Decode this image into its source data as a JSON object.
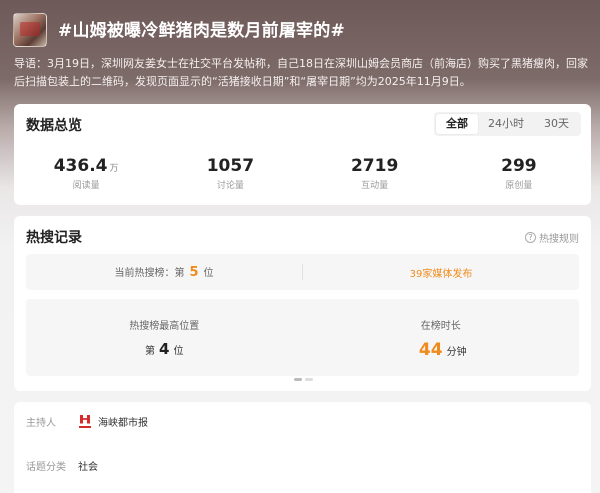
{
  "header": {
    "title": "#山姆被曝冷鲜猪肉是数月前屠宰的#",
    "lead": "导语：3月19日，深圳网友姜女士在社交平台发帖称，自己18日在深圳山姆会员商店（前海店）购买了黑猪瘦肉，回家后扫描包装上的二维码，发现页面显示的“活猪接收日期”和“屠宰日期”均为2025年11月9日。"
  },
  "overview": {
    "title": "数据总览",
    "tabs": [
      "全部",
      "24小时",
      "30天"
    ],
    "stats": [
      {
        "value": "436.4",
        "unit": "万",
        "label": "阅读量"
      },
      {
        "value": "1057",
        "unit": "",
        "label": "讨论量"
      },
      {
        "value": "2719",
        "unit": "",
        "label": "互动量"
      },
      {
        "value": "299",
        "unit": "",
        "label": "原创量"
      }
    ]
  },
  "hot": {
    "title": "热搜记录",
    "rule_link": "热搜规则",
    "current_label": "当前热搜榜：第",
    "current_rank": "5",
    "current_suffix": "位",
    "media_link": "39家媒体发布",
    "peak_label": "热搜榜最高位置",
    "peak_prefix": "第",
    "peak_value": "4",
    "peak_suffix": "位",
    "duration_label": "在榜时长",
    "duration_value": "44",
    "duration_unit": "分钟"
  },
  "info": {
    "host_label": "主持人",
    "host_value": "海峡都市报",
    "category_label": "话题分类",
    "category_value": "社会"
  }
}
